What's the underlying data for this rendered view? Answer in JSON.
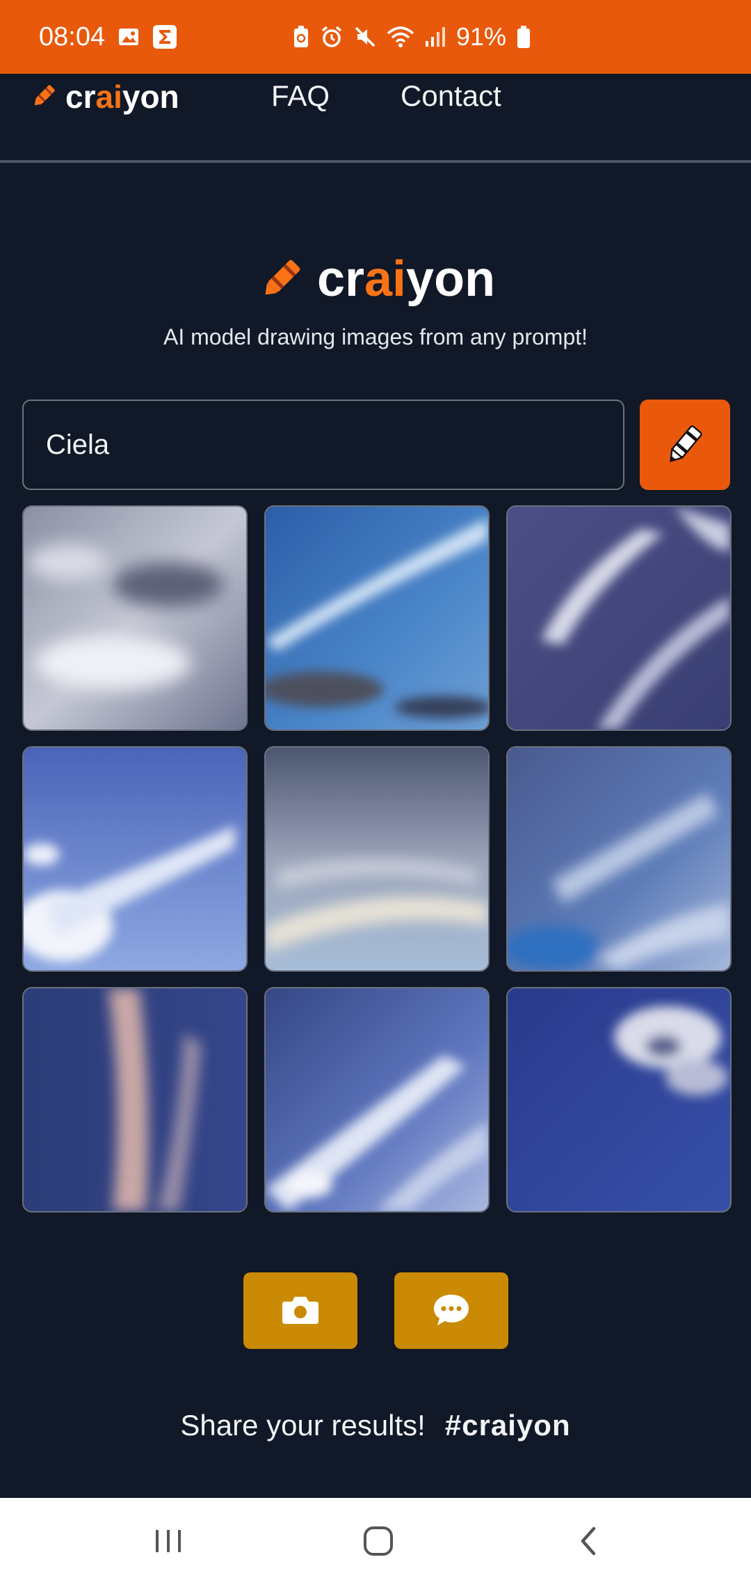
{
  "status_bar": {
    "time": "08:04",
    "battery": "91%",
    "icons": [
      "gallery-icon",
      "sigma-icon",
      "battery-saver-icon",
      "alarm-icon",
      "mute-icon",
      "wifi-icon",
      "signal-icon",
      "battery-icon"
    ],
    "background": "#e8590c"
  },
  "nav": {
    "logo_prefix": "cr",
    "logo_ai": "ai",
    "logo_suffix": "yon",
    "links": [
      "FAQ",
      "Contact"
    ]
  },
  "hero": {
    "logo_prefix": "cr",
    "logo_ai": "ai",
    "logo_suffix": "yon",
    "tagline": "AI model drawing images from any prompt!"
  },
  "prompt": {
    "value": "Ciela",
    "button_icon": "crayon-icon"
  },
  "results": {
    "count": 9,
    "tiles": [
      "sky-clouds-image-1",
      "sky-clouds-image-2",
      "sky-clouds-image-3",
      "sky-clouds-image-4",
      "sky-clouds-image-5",
      "sky-clouds-image-6",
      "sky-clouds-image-7",
      "sky-clouds-image-8",
      "sky-clouds-image-9"
    ]
  },
  "actions": {
    "screenshot_icon": "camera-icon",
    "feedback_icon": "chat-bubble-icon",
    "button_color": "#ca8a04"
  },
  "share": {
    "text": "Share your results!",
    "hashtag": "#craiyon"
  },
  "colors": {
    "background": "#111827",
    "accent": "#ea580c"
  },
  "system_nav": [
    "recents-icon",
    "home-icon",
    "back-icon"
  ]
}
